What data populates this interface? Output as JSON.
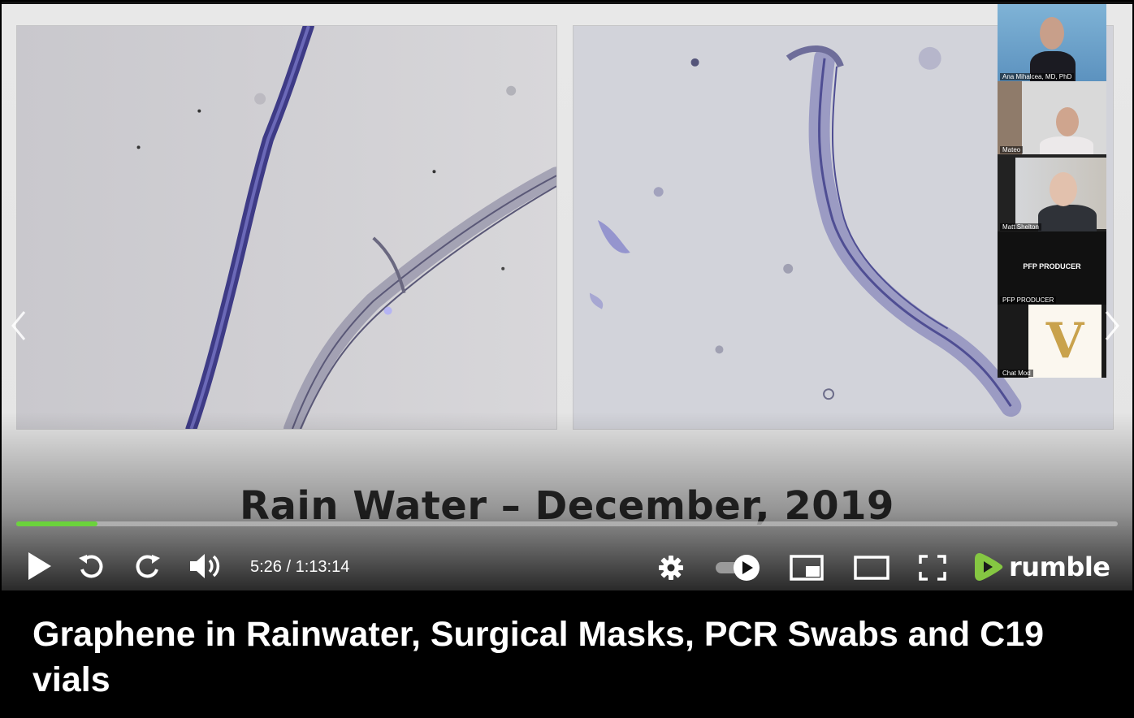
{
  "slide": {
    "caption": "Rain Water – December, 2019"
  },
  "participants": [
    {
      "name": "Ana Mihalcea, MD, PhD"
    },
    {
      "name": "Mateo"
    },
    {
      "name": "Matt Shelton"
    },
    {
      "name": "PFP PRODUCER",
      "center_text": "PFP PRODUCER"
    },
    {
      "name": "Chat Mod",
      "avatar_letter": "V"
    }
  ],
  "player": {
    "progress_fraction": 0.074,
    "current_time": "5:26",
    "duration": "1:13:14",
    "time_display": "5:26 / 1:13:14",
    "accent_color": "#6bd33c",
    "brand": "rumble",
    "icons": {
      "prev": "chevron-left-icon",
      "next": "chevron-right-icon",
      "play": "play-icon",
      "rewind": "rewind-icon",
      "forward": "forward-icon",
      "volume": "volume-icon",
      "settings": "gear-icon",
      "autoplay": "autoplay-toggle-icon",
      "pip": "picture-in-picture-icon",
      "theater": "theater-mode-icon",
      "fullscreen": "fullscreen-icon",
      "logo": "rumble-logo-icon"
    }
  },
  "video": {
    "title": "Graphene in Rainwater, Surgical Masks, PCR Swabs and C19 vials"
  }
}
